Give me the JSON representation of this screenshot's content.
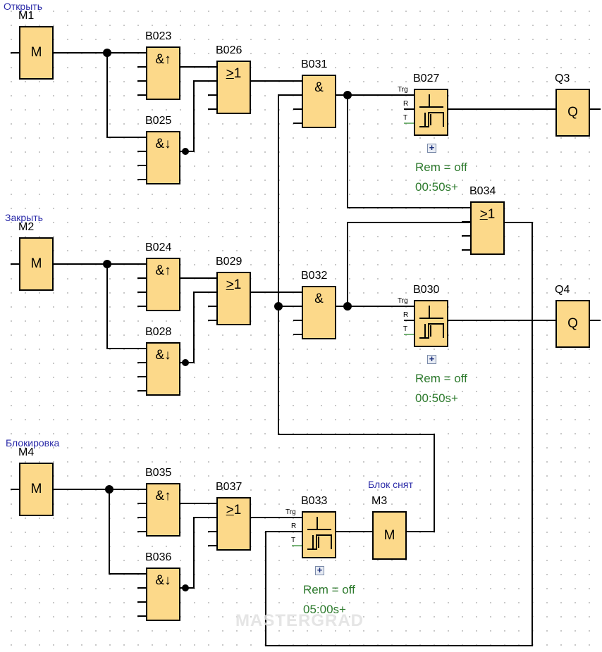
{
  "notes": {
    "open": "Открыть",
    "close": "Закрыть",
    "lock": "Блокировка",
    "unlock": "Блок снят"
  },
  "blocks": [
    {
      "id": "M1",
      "type": "flag",
      "symbol": "M"
    },
    {
      "id": "B023",
      "type": "gate",
      "symbol": "&↑"
    },
    {
      "id": "B025",
      "type": "gate",
      "symbol": "&↓"
    },
    {
      "id": "B026",
      "type": "gate",
      "symbol": "≥1"
    },
    {
      "id": "B031",
      "type": "gate",
      "symbol": "&"
    },
    {
      "id": "B027",
      "type": "timer",
      "symbol": ""
    },
    {
      "id": "Q3",
      "type": "output",
      "symbol": "Q"
    },
    {
      "id": "B034",
      "type": "gate",
      "symbol": "≥1"
    },
    {
      "id": "M2",
      "type": "flag",
      "symbol": "M"
    },
    {
      "id": "B024",
      "type": "gate",
      "symbol": "&↑"
    },
    {
      "id": "B028",
      "type": "gate",
      "symbol": "&↓"
    },
    {
      "id": "B029",
      "type": "gate",
      "symbol": "≥1"
    },
    {
      "id": "B032",
      "type": "gate",
      "symbol": "&"
    },
    {
      "id": "B030",
      "type": "timer",
      "symbol": ""
    },
    {
      "id": "Q4",
      "type": "output",
      "symbol": "Q"
    },
    {
      "id": "M4",
      "type": "flag",
      "symbol": "M"
    },
    {
      "id": "B035",
      "type": "gate",
      "symbol": "&↑"
    },
    {
      "id": "B036",
      "type": "gate",
      "symbol": "&↓"
    },
    {
      "id": "B037",
      "type": "gate",
      "symbol": "≥1"
    },
    {
      "id": "B033",
      "type": "timer",
      "symbol": ""
    },
    {
      "id": "M3",
      "type": "flag",
      "symbol": "M"
    }
  ],
  "timer_pins": [
    "Trg",
    "R",
    "T"
  ],
  "timer_params": {
    "B027": {
      "rem": "Rem = off",
      "time": "00:50s+"
    },
    "B030": {
      "rem": "Rem = off",
      "time": "00:50s+"
    },
    "B033": {
      "rem": "Rem = off",
      "time": "05:00s+"
    }
  },
  "expand_icon": "+",
  "watermark": "MASTERGRAD",
  "colors": {
    "block_fill": "#fcd98a",
    "note": "#2a2aa8",
    "param": "#2d7a2d",
    "wire": "#000000"
  }
}
